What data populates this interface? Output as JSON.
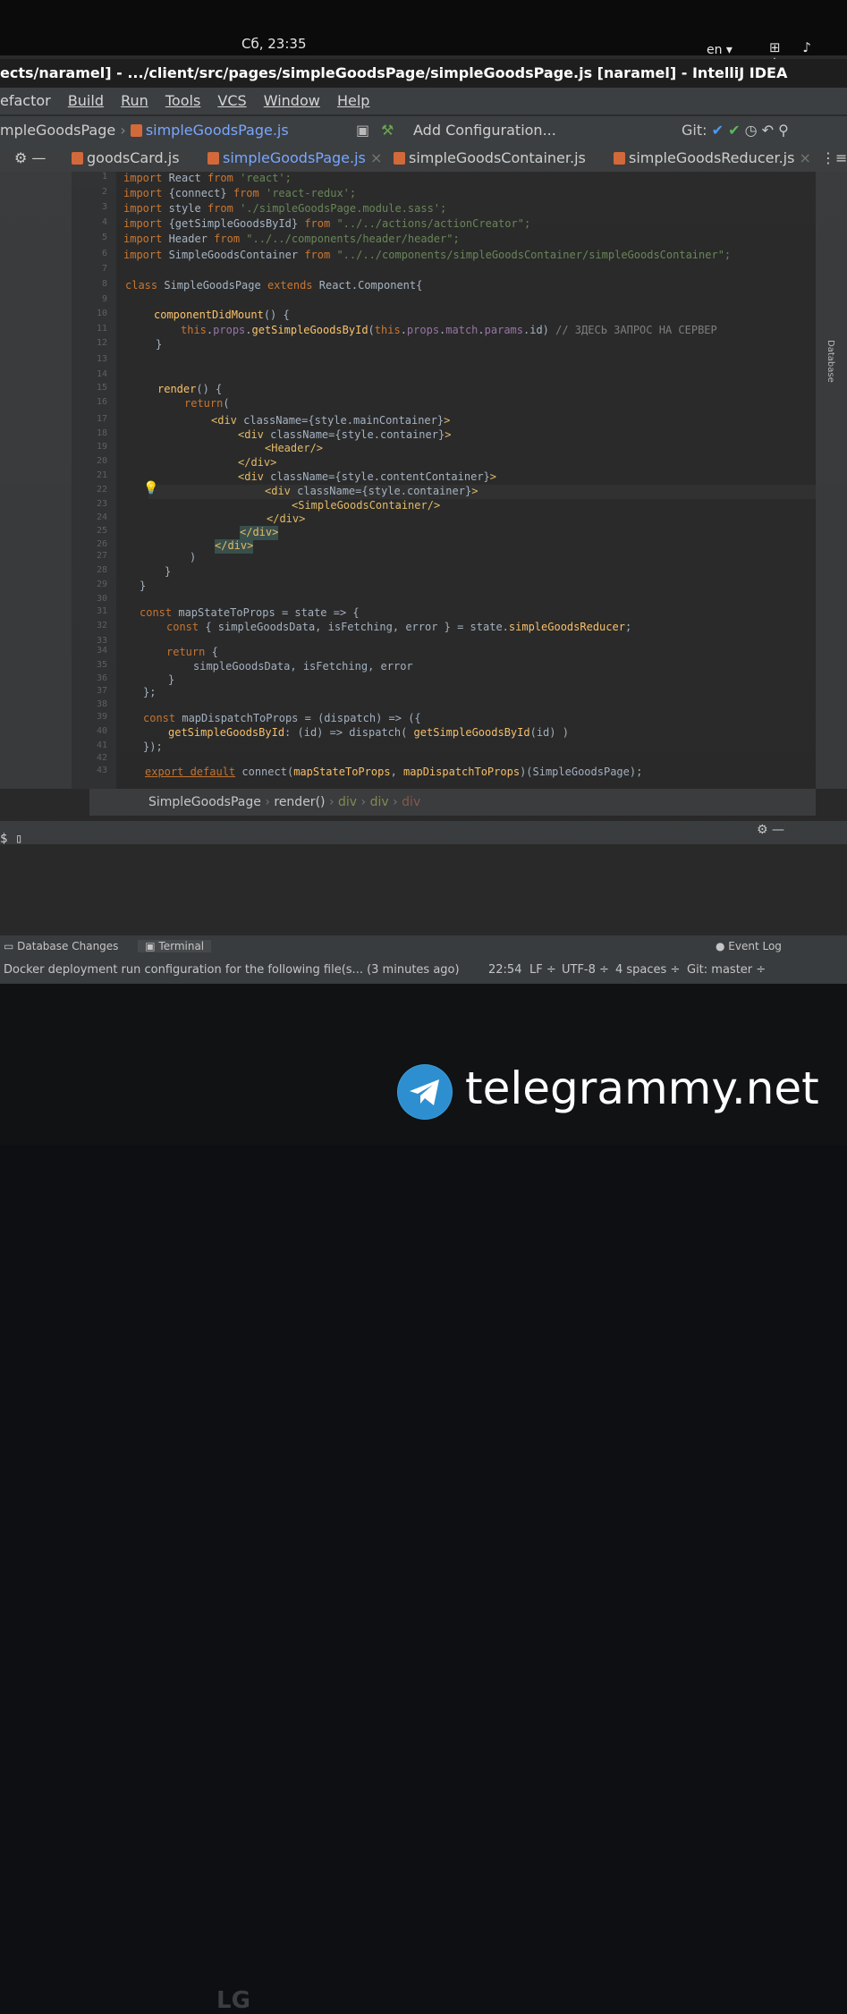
{
  "topbar": {
    "clock": "Сб, 23:35",
    "lang": "en ▾",
    "tray": "⊞ ♪ ⏻"
  },
  "window": {
    "title": "ects/naramel] - .../client/src/pages/simpleGoodsPage/simpleGoodsPage.js [naramel] - IntelliJ IDEA"
  },
  "menu": [
    "efactor",
    "Build",
    "Run",
    "Tools",
    "VCS",
    "Window",
    "Help"
  ],
  "navbar": {
    "crumb": "mpleGoodsPage",
    "file": "simpleGoodsPage.js",
    "add_config": "Add Configuration...",
    "git": "Git:"
  },
  "tabs": [
    "goodsCard.js",
    "simpleGoodsPage.js",
    "simpleGoodsContainer.js",
    "simpleGoodsReducer.js"
  ],
  "line_numbers": [
    "1",
    "2",
    "3",
    "4",
    "5",
    "6",
    "7",
    "8",
    "9",
    "10",
    "11",
    "12",
    "13",
    "14",
    "15",
    "16",
    "17",
    "18",
    "19",
    "20",
    "21",
    "22",
    "23",
    "24",
    "25",
    "26",
    "27",
    "28",
    "29",
    "30",
    "31",
    "32",
    "33",
    "34",
    "35",
    "36",
    "37",
    "38",
    "39",
    "40",
    "41",
    "42",
    "43"
  ],
  "code": {
    "l1": [
      "import",
      " React ",
      "from",
      " 'react';"
    ],
    "l2": [
      "import",
      " {connect} ",
      "from",
      " 'react-redux';"
    ],
    "l3": [
      "import",
      " style ",
      "from",
      " './simpleGoodsPage.module.sass';"
    ],
    "l4": [
      "import",
      " {getSimpleGoodsById} ",
      "from",
      " \"../../actions/actionCreator\";"
    ],
    "l5": [
      "import",
      " Header ",
      "from",
      " \"../../components/header/header\";"
    ],
    "l6": [
      "import",
      " SimpleGoodsContainer ",
      "from",
      " \"../../components/simpleGoodsContainer/simpleGoodsContainer\";"
    ],
    "l8": [
      "class",
      " SimpleGoodsPage ",
      "extends",
      " React.Component{"
    ],
    "l10": [
      "componentDidMount",
      "() {"
    ],
    "l11": [
      "this",
      ".",
      "props",
      ".",
      "getSimpleGoodsById",
      "(",
      "this",
      ".",
      "props",
      ".",
      "match",
      ".",
      "params",
      ".id) ",
      "// ЗДЕСЬ ЗАПРОС НА СЕРВЕР"
    ],
    "l12": "}",
    "l15": [
      "render",
      "() {"
    ],
    "l16": [
      "return",
      "("
    ],
    "l17": [
      "<div",
      " className=",
      "{style.mainContainer}",
      ">"
    ],
    "l18": [
      "<div",
      " className=",
      "{style.container}",
      ">"
    ],
    "l19": "<Header/>",
    "l20": "</div>",
    "l21": [
      "<div",
      " className=",
      "{style.contentContainer}",
      ">"
    ],
    "l22": [
      "<div",
      " className=",
      "{style.container}",
      ">"
    ],
    "l23": "<SimpleGoodsContainer/>",
    "l24": "</div>",
    "l25": "</div>",
    "l26": "</div>",
    "l27": ")",
    "l28": "}",
    "l29": "}",
    "l31": [
      "const",
      " mapStateToProps = state => {"
    ],
    "l32": [
      "const",
      " { simpleGoodsData, isFetching, error } = state.",
      "simpleGoodsReducer",
      ";"
    ],
    "l34": [
      "return",
      " {"
    ],
    "l35": "simpleGoodsData, isFetching, error",
    "l36": "}",
    "l37": "};",
    "l39": [
      "const",
      " mapDispatchToProps = (dispatch) => ({"
    ],
    "l40": [
      "getSimpleGoodsById",
      ": (id) => dispatch( ",
      "getSimpleGoodsById",
      "(id) )"
    ],
    "l41": "});",
    "l43": [
      "export default",
      " connect(",
      "mapStateToProps",
      ", ",
      "mapDispatchToProps",
      ")(SimpleGoodsPage);"
    ]
  },
  "breadcrumbs": [
    "SimpleGoodsPage",
    "render()",
    "div",
    "div",
    "div"
  ],
  "terminal": {
    "prompt": "$ ▯"
  },
  "bottom_tabs": {
    "db": "Database Changes",
    "terminal": "Terminal",
    "event_log": "Event Log"
  },
  "status": {
    "message": "Docker deployment run configuration for the following file(s... (3 minutes ago)",
    "position": "22:54",
    "lf": "LF ÷",
    "enc": "UTF-8 ÷",
    "indent": "4 spaces ÷",
    "git": "Git: master ÷"
  },
  "side_label": "Database",
  "bezel": {
    "brand": "LG"
  },
  "watermark": {
    "text": "telegrammy.net"
  },
  "colors": {
    "bg": "#2b2b2b",
    "keyword": "#cc7832",
    "string": "#6a8759",
    "function": "#ffc66d",
    "property": "#9876aa",
    "tag": "#e8bf6a"
  }
}
